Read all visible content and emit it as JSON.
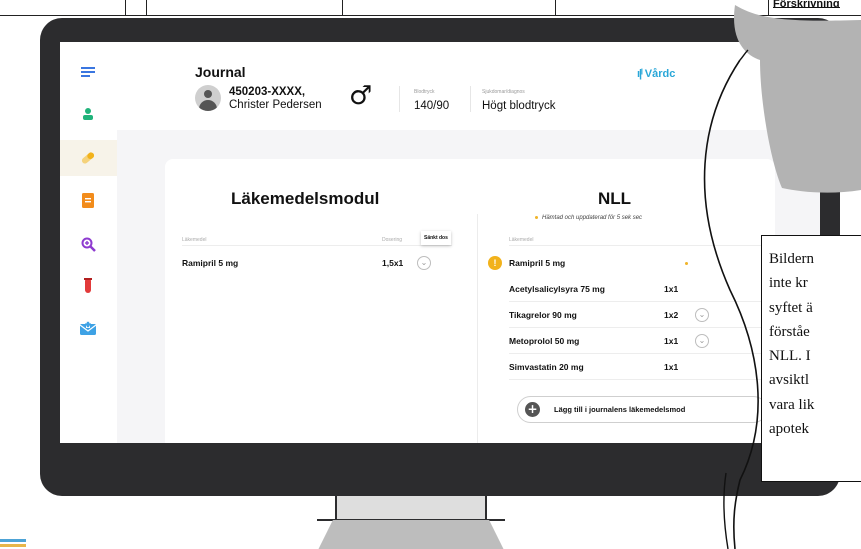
{
  "top_fragment": "Förskrivning",
  "screen": {
    "header": {
      "title": "Journal",
      "patient_id": "450203-XXXX,",
      "patient_name": "Christer Pedersen",
      "gender_symbol": "♂",
      "bp_label": "Blodtryck",
      "bp_value": "140/90",
      "diag_label": "Sjukdomar/diagnos",
      "diag_value": "Högt blodtryck",
      "brand": "Vårdc"
    },
    "sidebar_icons": [
      "menu-icon",
      "patient-icon",
      "pill-icon",
      "document-icon",
      "search-zoom-icon",
      "test-tube-icon",
      "medical-mail-icon"
    ],
    "left_panel": {
      "title": "Läkemedelsmodul",
      "col_med": "Läkemedel",
      "col_dose": "Dosering",
      "rows": [
        {
          "name": "Ramipril 5 mg",
          "dose": "1,5x1"
        }
      ]
    },
    "right_panel": {
      "title": "NLL",
      "subtitle": "Hämtad och uppdaterad  för 5 sek sec",
      "col_med": "Läkemedel",
      "tooltip": "Sänkt dos",
      "rows": [
        {
          "name": "Ramipril 5 mg",
          "dose": ""
        },
        {
          "name": "Acetylsalicylsyra 75 mg",
          "dose": "1x1"
        },
        {
          "name": "Tikagrelor 90 mg",
          "dose": "1x2"
        },
        {
          "name": "Metoprolol 50 mg",
          "dose": "1x1"
        },
        {
          "name": "Simvastatin 20 mg",
          "dose": "1x1"
        }
      ],
      "add_button": "Lägg till i journalens läkemedelsmod"
    }
  },
  "note_text": "Bildern\ninte kr\nsyftet ä\nförståe\nNLL. I\navsiktl\nvara lik\napotek",
  "colors": {
    "accent_blue": "#2aa7d8",
    "accent_green": "#20b37a",
    "accent_yellow": "#f2b21b",
    "accent_orange": "#f28c1b",
    "accent_red": "#e23a3a",
    "bezel": "#2c2c2e"
  }
}
